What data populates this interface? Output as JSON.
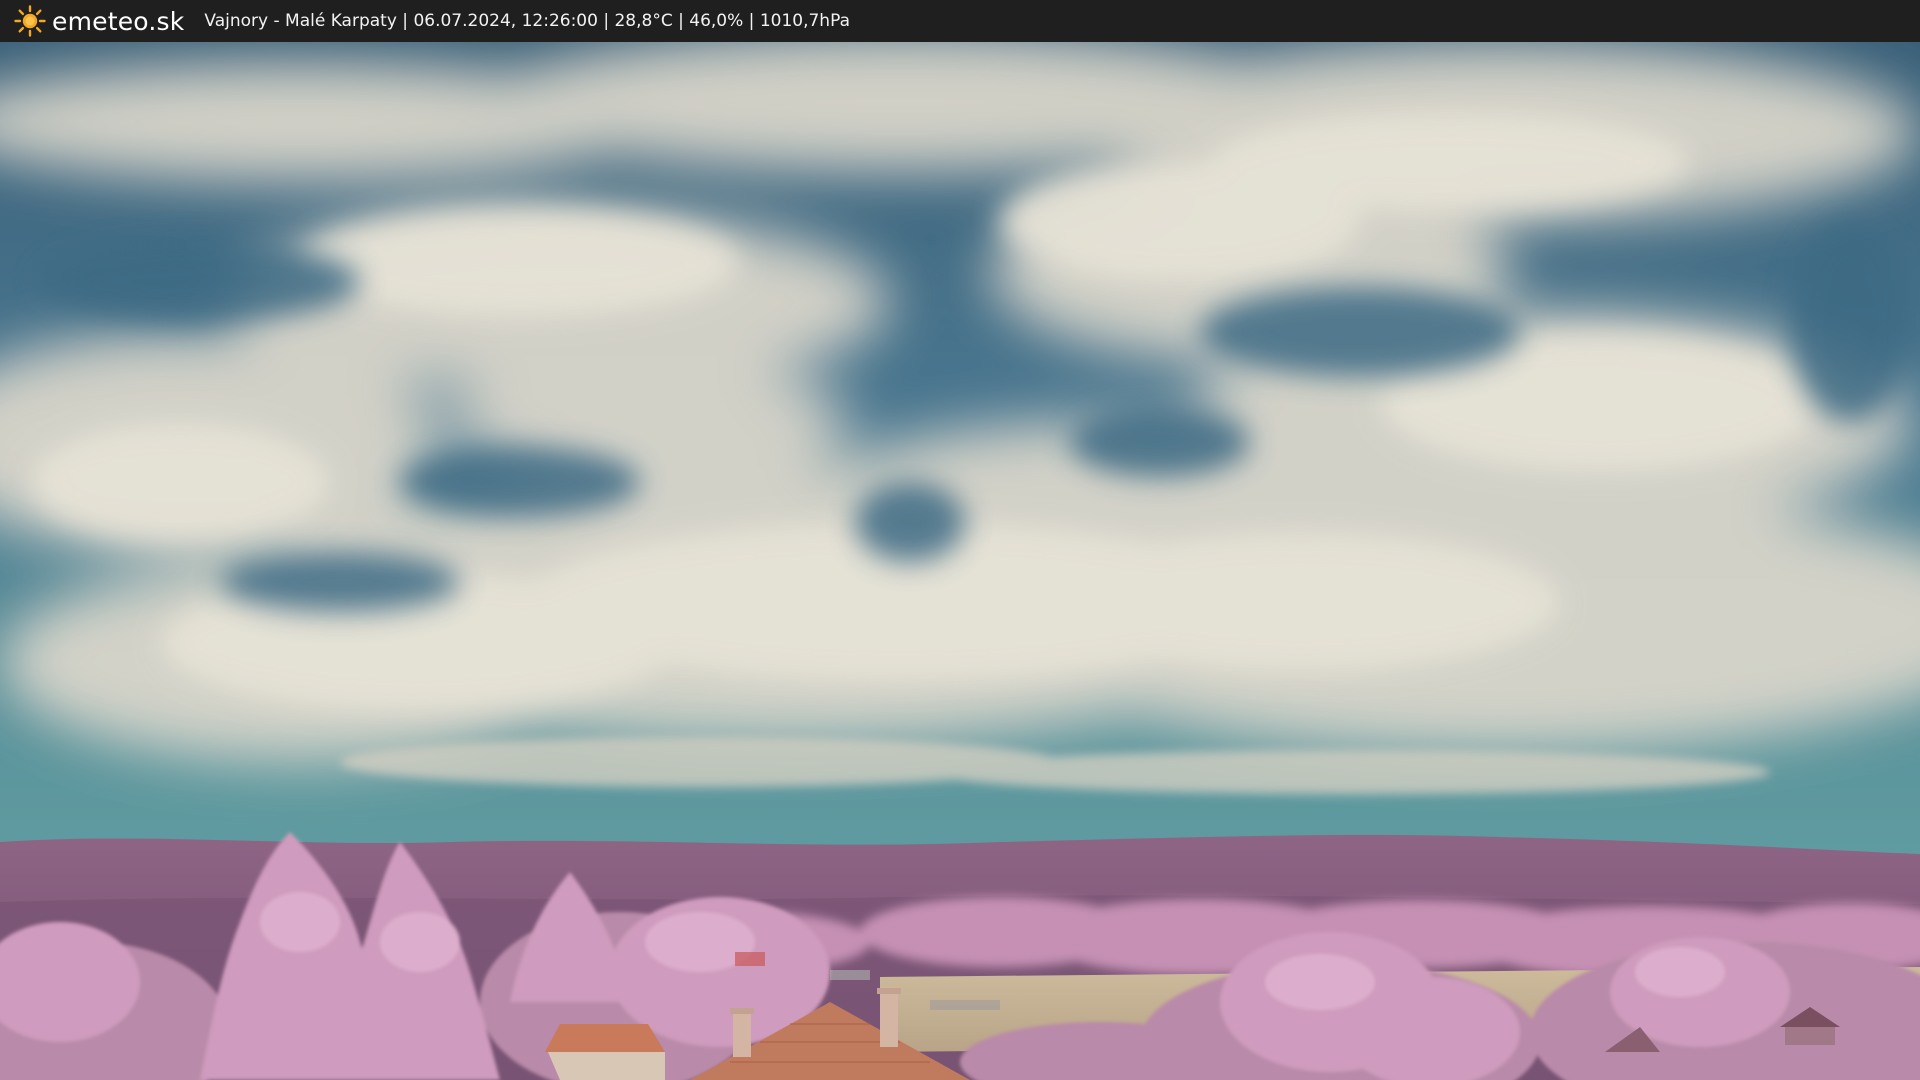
{
  "header": {
    "brand": "emeteo.sk",
    "location": "Vajnory - Malé Karpaty",
    "timestamp": "06.07.2024, 12:26:00",
    "temperature": "28,8°C",
    "humidity": "46,0%",
    "pressure": "1010,7hPa",
    "separator": " | ",
    "logo_icon": "sun-icon"
  },
  "colors": {
    "bar_background": "#1f1f1f",
    "sun": "#f5a623",
    "sky_blue": "#3f6b86",
    "cloud": "#dedbd0",
    "hills": "#8a5f7f",
    "foliage": "#c892b4",
    "field": "#c9b79a",
    "roof": "#c97a5a"
  }
}
